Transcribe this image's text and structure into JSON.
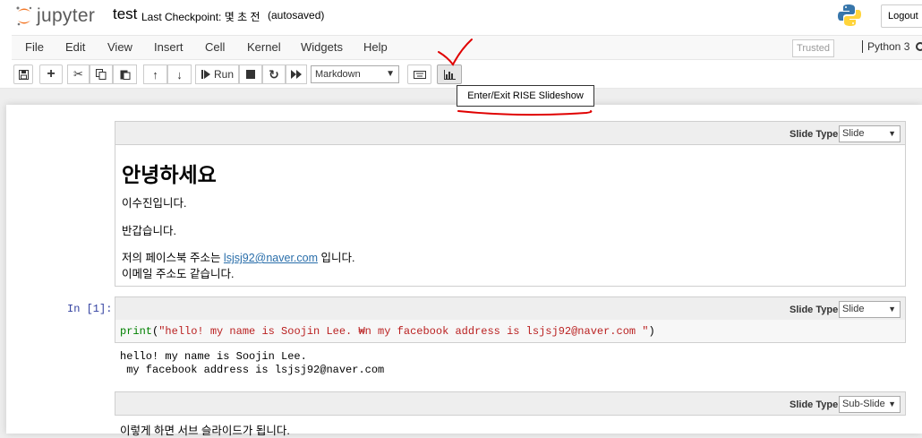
{
  "header": {
    "logo_text": "jupyter",
    "notebook_name": "test",
    "checkpoint": "Last Checkpoint: 몇 초 전",
    "autosave": "(autosaved)",
    "logout_label": "Logout"
  },
  "menubar": {
    "items": [
      "File",
      "Edit",
      "View",
      "Insert",
      "Cell",
      "Kernel",
      "Widgets",
      "Help"
    ],
    "trusted_label": "Trusted",
    "kernel_name": "Python 3"
  },
  "toolbar": {
    "run_label": "Run",
    "cell_type": "Markdown",
    "tooltip": "Enter/Exit RISE Slideshow"
  },
  "cells": {
    "c1": {
      "slide_label": "Slide Type",
      "slide_type": "Slide",
      "heading": "안녕하세요",
      "p1": "이수진입니다.",
      "p2": "반갑습니다.",
      "p3_pre": "저의 페이스북 주소는 ",
      "p3_link": "lsjsj92@naver.com",
      "p3_post": " 입니다.",
      "p4": "이메일 주소도 같습니다."
    },
    "c2": {
      "prompt": "In [1]:",
      "slide_label": "Slide Type",
      "slide_type": "Slide",
      "code_fn": "print",
      "code_open": "(",
      "code_str": "\"hello! my name is Soojin Lee. ₩n my facebook address is lsjsj92@naver.com \"",
      "code_close": ")",
      "out1": "hello! my name is Soojin Lee.",
      "out2": " my facebook address is lsjsj92@naver.com"
    },
    "c3": {
      "slide_label": "Slide Type",
      "slide_type": "Sub-Slide",
      "text": "이렇게 하면 서브 슬라이드가 됩니다."
    }
  },
  "icons": [
    "save-icon",
    "plus-icon",
    "cut-icon",
    "copy-icon",
    "paste-icon",
    "arrow-up-icon",
    "arrow-down-icon",
    "step-forward-icon",
    "stop-icon",
    "restart-icon",
    "fast-forward-icon",
    "keyboard-icon",
    "bar-chart-icon",
    "python-logo"
  ],
  "colors": {
    "annotation": "#e00000",
    "link": "#296eaa",
    "prompt": "#303f9f"
  }
}
